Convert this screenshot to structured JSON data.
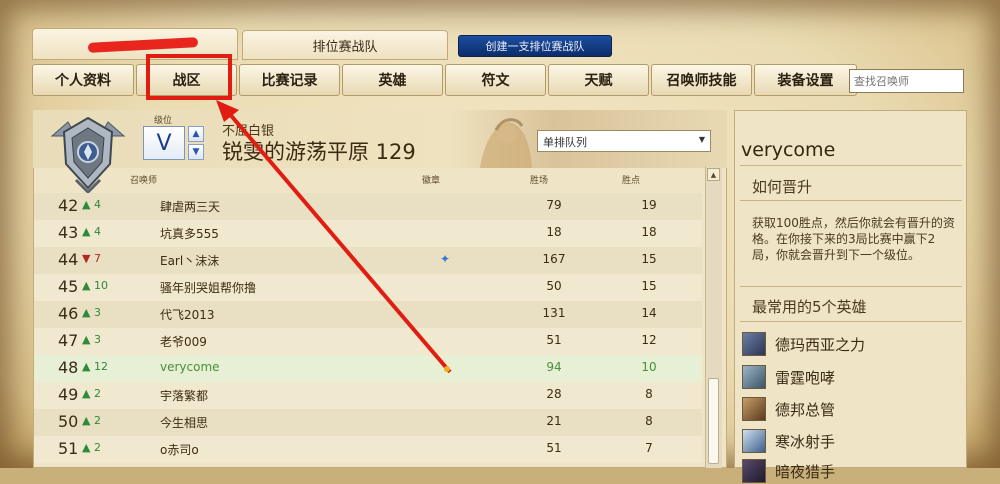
{
  "top_tabs": {
    "profile_tab": "",
    "ranked_team_tab": "排位赛战队",
    "create_team_button": "创建一支排位赛战队"
  },
  "nav": {
    "items": [
      "个人资料",
      "战区",
      "比赛记录",
      "英雄",
      "符文",
      "天赋",
      "召唤师技能",
      "装备设置"
    ],
    "search_placeholder": "查找召唤师"
  },
  "league": {
    "rank_label": "级位",
    "division": "V",
    "tier_text": "不屈白银",
    "league_name": "锐雯的游荡平原 129",
    "queue_selected": "单排队列"
  },
  "table": {
    "headers": {
      "summoner": "召唤师",
      "badges": "徽章",
      "wins": "胜场",
      "points": "胜点"
    },
    "rows": [
      {
        "rank": "42",
        "change": "4",
        "dir": "up",
        "name": "肆虐两三天",
        "wins": "79",
        "points": "19"
      },
      {
        "rank": "43",
        "change": "4",
        "dir": "up",
        "name": "坑真多555",
        "wins": "18",
        "points": "18"
      },
      {
        "rank": "44",
        "change": "7",
        "dir": "down",
        "name": "Earl丶沫沫",
        "wins": "167",
        "points": "15",
        "badge": "✦"
      },
      {
        "rank": "45",
        "change": "10",
        "dir": "up",
        "name": "骚年别哭姐帮你撸",
        "wins": "50",
        "points": "15"
      },
      {
        "rank": "46",
        "change": "3",
        "dir": "up",
        "name": "代飞2013",
        "wins": "131",
        "points": "14"
      },
      {
        "rank": "47",
        "change": "3",
        "dir": "up",
        "name": "老爷009",
        "wins": "51",
        "points": "12"
      },
      {
        "rank": "48",
        "change": "12",
        "dir": "up",
        "name": "verycome",
        "wins": "94",
        "points": "10"
      },
      {
        "rank": "49",
        "change": "2",
        "dir": "up",
        "name": "宇落繁都",
        "wins": "28",
        "points": "8"
      },
      {
        "rank": "50",
        "change": "2",
        "dir": "up",
        "name": "今生相思",
        "wins": "21",
        "points": "8"
      },
      {
        "rank": "51",
        "change": "2",
        "dir": "up",
        "name": "o赤司o",
        "wins": "51",
        "points": "7"
      }
    ]
  },
  "side": {
    "username": "verycome",
    "promotion_title": "如何晋升",
    "promotion_desc": "获取100胜点，然后你就会有晋升的资格。在你接下来的3局比赛中赢下2局，你就会晋升到下一个级位。",
    "top_champs_title": "最常用的5个英雄",
    "champions": [
      "德玛西亚之力",
      "雷霆咆哮",
      "德邦总管",
      "寒冰射手",
      "暗夜猎手"
    ]
  },
  "colors": {
    "highlight_red": "#e11d12",
    "up_green": "#2f8a3a",
    "down_red": "#b22a22",
    "button_blue": "#1d4ea0"
  }
}
